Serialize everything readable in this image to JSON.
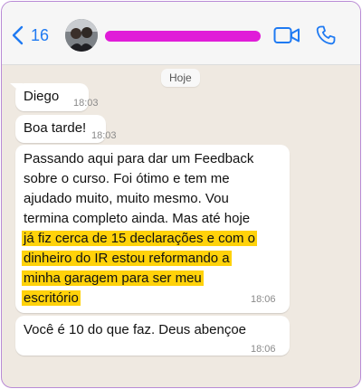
{
  "header": {
    "back_count": "16"
  },
  "chat": {
    "date_label": "Hoje",
    "messages": [
      {
        "text": "Diego",
        "time": "18:03"
      },
      {
        "text": "Boa tarde!",
        "time": "18:03"
      },
      {
        "lines": [
          "Passando aqui para dar um Feedback",
          "sobre o curso. Foi ótimo e tem me",
          "ajudado muito, muito mesmo. Vou",
          "termina completo ainda. Mas até hoje",
          "já fiz cerca de 15 declarações e com o",
          "dinheiro do IR estou reformando a",
          "minha garagem para ser meu",
          "escritório"
        ],
        "time": "18:06"
      },
      {
        "text": "Você é 10 do que faz. Deus abençoe",
        "time": "18:06"
      }
    ]
  },
  "colors": {
    "accent": "#1f7af2",
    "highlight": "#ffd20a",
    "redaction": "#e01cd8",
    "chat_background": "#efe9e1",
    "frame_border": "#b98ad6"
  },
  "icons": {
    "back": "chevron-left-icon",
    "video": "video-camera-icon",
    "call": "phone-icon"
  }
}
